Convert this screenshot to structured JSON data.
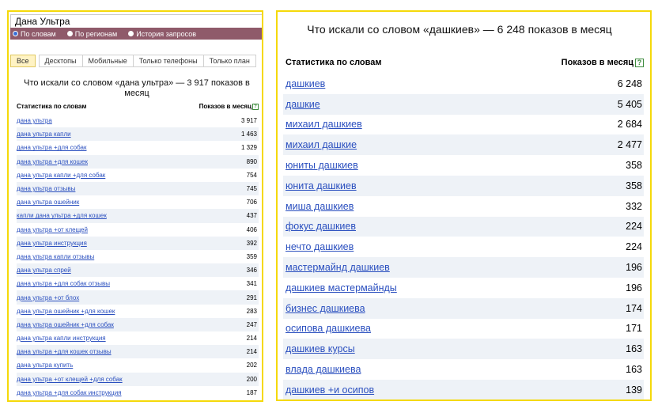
{
  "left": {
    "search_value": "Дана Ультра",
    "modes": [
      {
        "label": "По словам",
        "checked": true
      },
      {
        "label": "По регионам",
        "checked": false
      },
      {
        "label": "История запросов",
        "checked": false
      }
    ],
    "tabs": [
      "Все",
      "Десктопы",
      "Мобильные",
      "Только телефоны",
      "Только план"
    ],
    "title": "Что искали со словом «дана ультра» — 3 917 показов в месяц",
    "col_keyword": "Статистика по словам",
    "col_count": "Показов в месяц",
    "help_glyph": "?",
    "rows": [
      {
        "kw": "дана ультра",
        "count": "3 917"
      },
      {
        "kw": "дана ультра капли",
        "count": "1 463"
      },
      {
        "kw": "дана ультра +для собак",
        "count": "1 329"
      },
      {
        "kw": "дана ультра +для кошек",
        "count": "890"
      },
      {
        "kw": "дана ультра капли +для собак",
        "count": "754"
      },
      {
        "kw": "дана ультра отзывы",
        "count": "745"
      },
      {
        "kw": "дана ультра ошейник",
        "count": "706"
      },
      {
        "kw": "капли дана ультра +для кошек",
        "count": "437"
      },
      {
        "kw": "дана ультра +от клещей",
        "count": "406"
      },
      {
        "kw": "дана ультра инструкция",
        "count": "392"
      },
      {
        "kw": "дана ультра капли отзывы",
        "count": "359"
      },
      {
        "kw": "дана ультра спрей",
        "count": "346"
      },
      {
        "kw": "дана ультра +для собак отзывы",
        "count": "341"
      },
      {
        "kw": "дана ультра +от блох",
        "count": "291"
      },
      {
        "kw": "дана ультра ошейник +для кошек",
        "count": "283"
      },
      {
        "kw": "дана ультра ошейник +для собак",
        "count": "247"
      },
      {
        "kw": "дана ультра капли инструкция",
        "count": "214"
      },
      {
        "kw": "дана ультра +для кошек отзывы",
        "count": "214"
      },
      {
        "kw": "дана ультра купить",
        "count": "202"
      },
      {
        "kw": "дана ультра +от клещей +для собак",
        "count": "200"
      },
      {
        "kw": "дана ультра +для собак инструкция",
        "count": "187"
      }
    ]
  },
  "right": {
    "title": "Что искали со словом «дашкиев» — 6 248 показов в месяц",
    "col_keyword": "Статистика по словам",
    "col_count": "Показов в месяц",
    "help_glyph": "?",
    "rows": [
      {
        "kw": "дашкиев",
        "count": "6 248"
      },
      {
        "kw": "дашкие",
        "count": "5 405"
      },
      {
        "kw": "михаил дашкиев",
        "count": "2 684"
      },
      {
        "kw": "михаил дашкие",
        "count": "2 477"
      },
      {
        "kw": "юниты дашкиев",
        "count": "358"
      },
      {
        "kw": "юнита дашкиев",
        "count": "358"
      },
      {
        "kw": "миша дашкиев",
        "count": "332"
      },
      {
        "kw": "фокус дашкиев",
        "count": "224"
      },
      {
        "kw": "нечто дашкиев",
        "count": "224"
      },
      {
        "kw": "мастермайнд дашкиев",
        "count": "196"
      },
      {
        "kw": "дашкиев мастермайнды",
        "count": "196"
      },
      {
        "kw": "бизнес дашкиева",
        "count": "174"
      },
      {
        "kw": "осипова дашкиева",
        "count": "171"
      },
      {
        "kw": "дашкиев курсы",
        "count": "163"
      },
      {
        "kw": "влада дашкиева",
        "count": "163"
      },
      {
        "kw": "дашкиев +и осипов",
        "count": "139"
      }
    ]
  },
  "colors": {
    "frame": "#f5d90a",
    "mode_bar": "#8f5a6a",
    "link": "#2a4fbf",
    "stripe": "#eef2f7",
    "help": "#3c8a3c"
  }
}
